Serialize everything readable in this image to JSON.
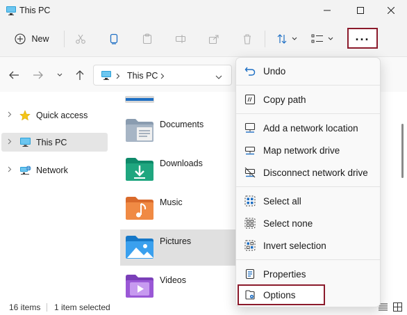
{
  "window": {
    "title": "This PC"
  },
  "toolbar": {
    "new_label": "New",
    "more_label": "..."
  },
  "address": {
    "location": "This PC"
  },
  "sidebar": {
    "items": [
      {
        "label": "Quick access",
        "icon": "star-icon"
      },
      {
        "label": "This PC",
        "icon": "monitor-icon",
        "selected": true
      },
      {
        "label": "Network",
        "icon": "network-icon"
      }
    ]
  },
  "folders": [
    {
      "label": "Documents",
      "icon": "documents-folder-icon"
    },
    {
      "label": "Downloads",
      "icon": "downloads-folder-icon"
    },
    {
      "label": "Music",
      "icon": "music-folder-icon"
    },
    {
      "label": "Pictures",
      "icon": "pictures-folder-icon",
      "selected": true
    },
    {
      "label": "Videos",
      "icon": "videos-folder-icon"
    }
  ],
  "status": {
    "item_count": "16 items",
    "selection": "1 item selected"
  },
  "menu": {
    "items": [
      {
        "label": "Undo",
        "icon": "undo-icon"
      },
      {
        "label": "Copy path",
        "icon": "copy-path-icon"
      },
      {
        "label": "Add a network location",
        "icon": "add-network-location-icon"
      },
      {
        "label": "Map network drive",
        "icon": "map-network-drive-icon"
      },
      {
        "label": "Disconnect network drive",
        "icon": "disconnect-network-drive-icon"
      },
      {
        "label": "Select all",
        "icon": "select-all-icon"
      },
      {
        "label": "Select none",
        "icon": "select-none-icon"
      },
      {
        "label": "Invert selection",
        "icon": "invert-selection-icon"
      },
      {
        "label": "Properties",
        "icon": "properties-icon"
      },
      {
        "label": "Options",
        "icon": "options-icon",
        "highlighted": true
      }
    ]
  },
  "colors": {
    "highlight_border": "#8b1a2b",
    "accent_blue": "#1e6fc4",
    "selection_gray": "#e5e5e5"
  }
}
